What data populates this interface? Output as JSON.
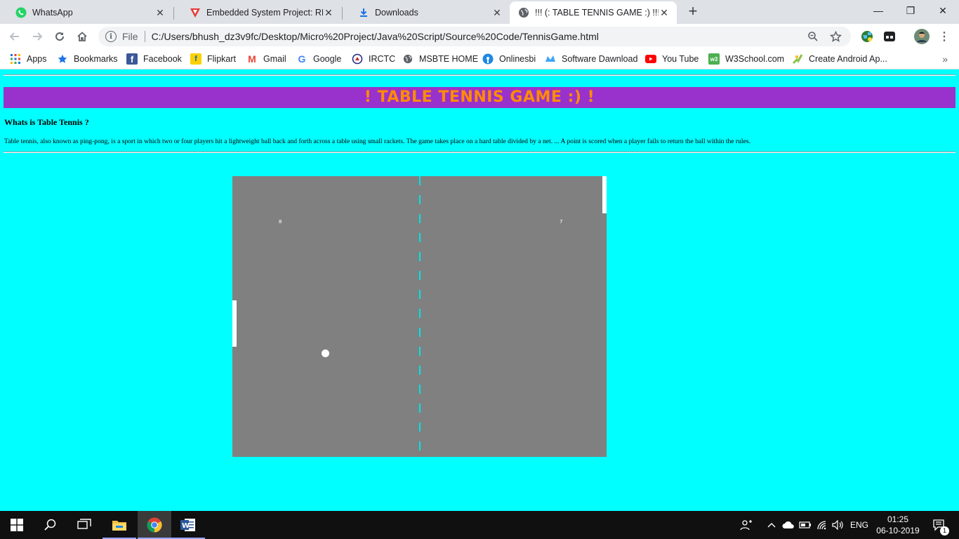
{
  "browser": {
    "tabs": [
      {
        "title": "WhatsApp",
        "icon": "whatsapp-icon",
        "active": false
      },
      {
        "title": "Embedded System Project: RFID B",
        "icon": "embedded-site-icon",
        "active": false
      },
      {
        "title": "Downloads",
        "icon": "download-icon",
        "active": false
      },
      {
        "title": "!!! (: TABLE TENNIS GAME :) !!!",
        "icon": "globe-icon",
        "active": true
      }
    ],
    "new_tab": "+",
    "window_controls": {
      "minimize": "—",
      "restore": "❐",
      "close": "✕"
    },
    "address": {
      "scheme": "File",
      "url": "C:/Users/bhush_dz3v9fc/Desktop/Micro%20Project/Java%20Script/Source%20Code/TennisGame.html"
    },
    "bookmarks": [
      {
        "label": "Apps",
        "icon": "apps-grid-icon"
      },
      {
        "label": "Bookmarks",
        "icon": "star-icon"
      },
      {
        "label": "Facebook",
        "icon": "facebook-icon"
      },
      {
        "label": "Flipkart",
        "icon": "flipkart-icon"
      },
      {
        "label": "Gmail",
        "icon": "gmail-icon"
      },
      {
        "label": "Google",
        "icon": "google-icon"
      },
      {
        "label": "IRCTC",
        "icon": "irctc-icon"
      },
      {
        "label": "MSBTE HOME",
        "icon": "globe-icon"
      },
      {
        "label": "Onlinesbi",
        "icon": "sbi-icon"
      },
      {
        "label": "Software Dawnload",
        "icon": "software-icon"
      },
      {
        "label": "You Tube",
        "icon": "youtube-icon"
      },
      {
        "label": "W3School.com",
        "icon": "w3schools-icon"
      },
      {
        "label": "Create Android Ap...",
        "icon": "android-icon"
      }
    ],
    "bookmarks_more": "»"
  },
  "page": {
    "banner_title": "! TABLE TENNIS GAME :) !",
    "heading": "Whats is Table Tennis ?",
    "description": "Table tennis, also known as ping-pong, is a sport in which two or four players hit a lightweight ball back and forth across a table using small rackets. The game takes place on a hard table divided by a net. ... A point is scored when a player fails to return the ball within the rules.",
    "colors": {
      "background": "#00ffff",
      "banner": "#9932cc",
      "banner_text": "#ff8c00",
      "table": "#808080"
    }
  },
  "game": {
    "left_score": "8",
    "right_score": "7"
  },
  "taskbar": {
    "time": "01:25",
    "date": "06-10-2019",
    "language": "ENG",
    "notification_count": "1"
  }
}
